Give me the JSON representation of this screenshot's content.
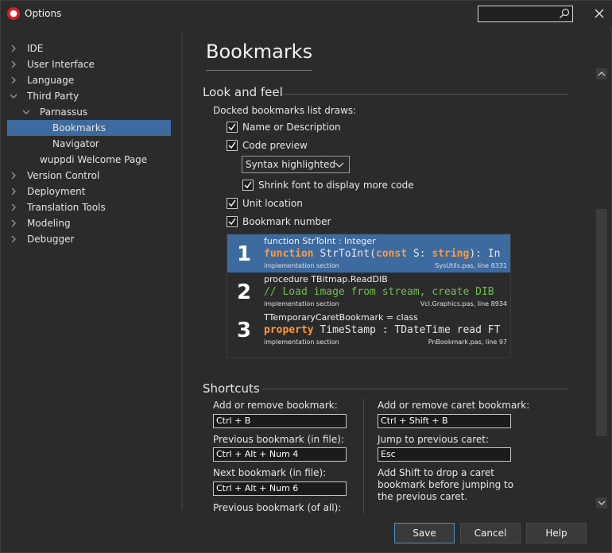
{
  "window": {
    "title": "Options",
    "search_placeholder": ""
  },
  "tree": [
    {
      "label": "IDE",
      "depth": 0,
      "expander": "collapsed"
    },
    {
      "label": "User Interface",
      "depth": 0,
      "expander": "collapsed"
    },
    {
      "label": "Language",
      "depth": 0,
      "expander": "collapsed"
    },
    {
      "label": "Third Party",
      "depth": 0,
      "expander": "expanded"
    },
    {
      "label": "Parnassus",
      "depth": 1,
      "expander": "expanded"
    },
    {
      "label": "Bookmarks",
      "depth": 2,
      "expander": "none",
      "selected": true
    },
    {
      "label": "Navigator",
      "depth": 2,
      "expander": "none"
    },
    {
      "label": "wuppdi Welcome Page",
      "depth": 1,
      "expander": "none"
    },
    {
      "label": "Version Control",
      "depth": 0,
      "expander": "collapsed"
    },
    {
      "label": "Deployment",
      "depth": 0,
      "expander": "collapsed"
    },
    {
      "label": "Translation Tools",
      "depth": 0,
      "expander": "collapsed"
    },
    {
      "label": "Modeling",
      "depth": 0,
      "expander": "collapsed"
    },
    {
      "label": "Debugger",
      "depth": 0,
      "expander": "collapsed"
    }
  ],
  "page": {
    "title": "Bookmarks"
  },
  "look_and_feel": {
    "group_title": "Look and feel",
    "list_label": "Docked bookmarks list draws:",
    "name_or_description": {
      "label": "Name or Description",
      "checked": true
    },
    "code_preview": {
      "label": "Code preview",
      "checked": true
    },
    "syntax_mode": "Syntax highlighted",
    "shrink_font": {
      "label": "Shrink font to display more code",
      "checked": true
    },
    "unit_location": {
      "label": "Unit location",
      "checked": true
    },
    "bookmark_number": {
      "label": "Bookmark number",
      "checked": true
    }
  },
  "preview": {
    "items": [
      {
        "number": "1",
        "name": "function StrToInt : Integer",
        "code_parts": [
          [
            "kw",
            "function "
          ],
          [
            "id",
            "StrToInt("
          ],
          [
            "kw",
            "const "
          ],
          [
            "id",
            "S: "
          ],
          [
            "kw",
            "string"
          ],
          [
            "id",
            "): In"
          ]
        ],
        "section": "implementation section",
        "file": "SysUtils.pas, line 8331"
      },
      {
        "number": "2",
        "name": "procedure TBitmap.ReadDIB",
        "code_parts": [
          [
            "cmt",
            "// Load image from stream, create DIB"
          ]
        ],
        "section": "implementation section",
        "file": "Vcl.Graphics.pas, line 8934"
      },
      {
        "number": "3",
        "name": "TTemporaryCaretBookmark = class",
        "code_parts": [
          [
            "kw",
            "property "
          ],
          [
            "id",
            "TimeStamp : TDateTime read FT"
          ]
        ],
        "section": "implementation section",
        "file": "PnBookmark.pas, line 97"
      }
    ]
  },
  "shortcuts": {
    "group_title": "Shortcuts",
    "add_remove_label": "Add or remove bookmark:",
    "add_remove_value": "Ctrl + B",
    "prev_file_label": "Previous bookmark (in file):",
    "prev_file_value": "Ctrl + Alt + Num 4",
    "next_file_label": "Next bookmark (in file):",
    "next_file_value": "Ctrl + Alt + Num 6",
    "prev_all_label": "Previous bookmark (of all):",
    "add_caret_label": "Add or remove caret bookmark:",
    "add_caret_value": "Ctrl + Shift + B",
    "jump_caret_label": "Jump to previous caret:",
    "jump_caret_value": "Esc",
    "hint_line1": "Add Shift to drop a caret",
    "hint_line2": "bookmark before jumping to",
    "hint_line3": "the previous caret."
  },
  "buttons": {
    "save": "Save",
    "cancel": "Cancel",
    "help": "Help"
  },
  "colors": {
    "accent": "#3d6a9f",
    "keyword": "#ff9a3c",
    "comment": "#6fbf4f",
    "background": "#2b2b2b"
  },
  "icons": {
    "app": "app-logo-icon",
    "search": "search-icon",
    "close": "close-icon"
  }
}
